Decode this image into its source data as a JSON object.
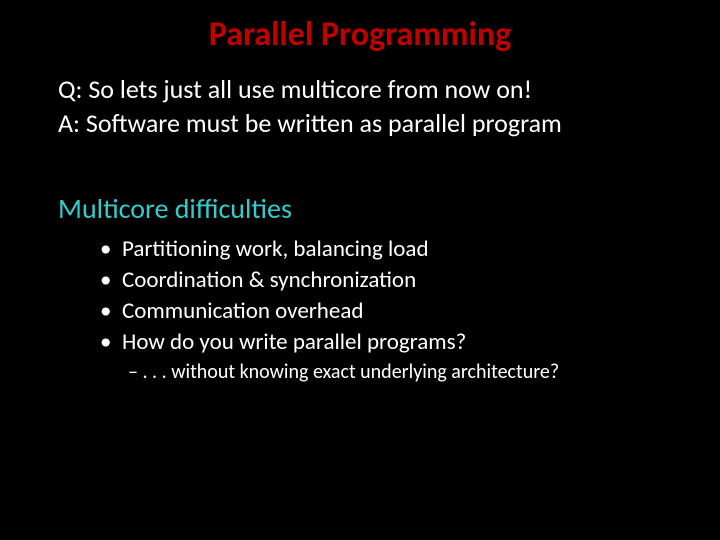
{
  "title": "Parallel Programming",
  "qa": {
    "q": "Q: So lets just all use multicore from now on!",
    "a": "A: Software must be written as parallel program"
  },
  "subhead": "Multicore difficulties",
  "bullets": [
    "Partitioning work, balancing load",
    "Coordination & synchronization",
    "Communication overhead",
    "How do you write parallel programs?"
  ],
  "subline": "– . . . without knowing exact underlying architecture?"
}
